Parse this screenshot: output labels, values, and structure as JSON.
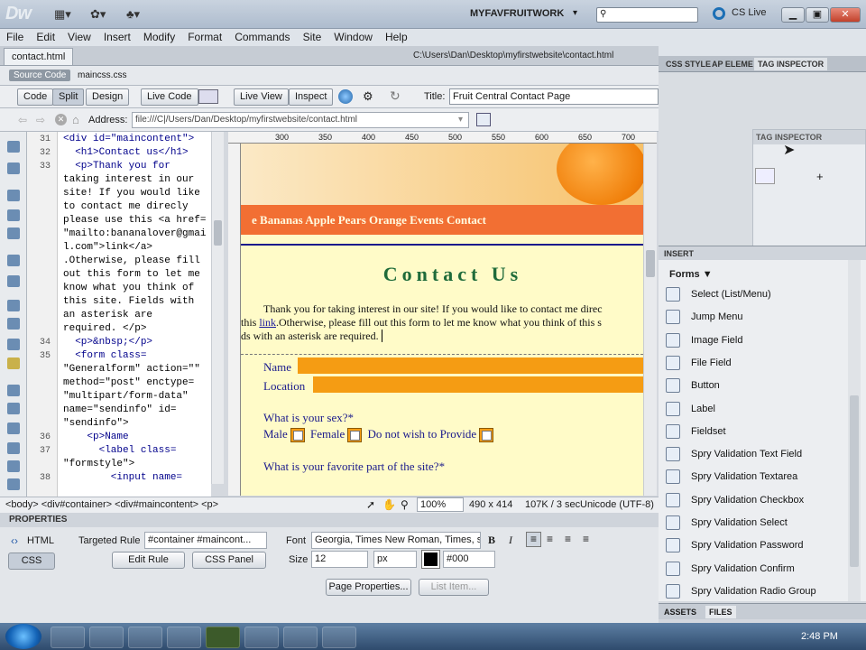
{
  "app": {
    "logo": "Dw",
    "workspace": "MYFAVFRUITWORK",
    "cs_live": "CS Live"
  },
  "menu": [
    "File",
    "Edit",
    "View",
    "Insert",
    "Modify",
    "Format",
    "Commands",
    "Site",
    "Window",
    "Help"
  ],
  "document": {
    "tab": "contact.html",
    "path": "C:\\Users\\Dan\\Desktop\\myfirstwebsite\\contact.html",
    "source_code": "Source Code",
    "related_file": "maincss.css"
  },
  "toolbar": {
    "code": "Code",
    "split": "Split",
    "design": "Design",
    "live_code": "Live Code",
    "live_view": "Live View",
    "inspect": "Inspect",
    "title_label": "Title:",
    "title_value": "Fruit Central Contact Page"
  },
  "address": {
    "label": "Address:",
    "value": "file:///C|/Users/Dan/Desktop/myfirstwebsite/contact.html"
  },
  "code_lines": [
    {
      "num": "31",
      "text": "<div id=\"maincontent\">"
    },
    {
      "num": "32",
      "text": "  <h1>Contact us</h1>"
    },
    {
      "num": "33",
      "text": "  <p>Thank you for"
    },
    {
      "num": "",
      "text": "taking interest in our"
    },
    {
      "num": "",
      "text": "site! If you would like"
    },
    {
      "num": "",
      "text": "to contact me direcly"
    },
    {
      "num": "",
      "text": "please use this <a href="
    },
    {
      "num": "",
      "text": "\"mailto:bananalover@gmai"
    },
    {
      "num": "",
      "text": "l.com\">link</a>"
    },
    {
      "num": "",
      "text": ".Otherwise, please fill"
    },
    {
      "num": "",
      "text": "out this form to let me"
    },
    {
      "num": "",
      "text": "know what you think of"
    },
    {
      "num": "",
      "text": "this site. Fields with"
    },
    {
      "num": "",
      "text": "an asterisk are"
    },
    {
      "num": "",
      "text": "required. </p>"
    },
    {
      "num": "34",
      "text": "  <p>&nbsp;</p>"
    },
    {
      "num": "35",
      "text": "  <form class="
    },
    {
      "num": "",
      "text": "\"Generalform\" action=\"\""
    },
    {
      "num": "",
      "text": "method=\"post\" enctype="
    },
    {
      "num": "",
      "text": "\"multipart/form-data\""
    },
    {
      "num": "",
      "text": "name=\"sendinfo\" id="
    },
    {
      "num": "",
      "text": "\"sendinfo\">"
    },
    {
      "num": "36",
      "text": "    <p>Name"
    },
    {
      "num": "37",
      "text": "      <label class="
    },
    {
      "num": "",
      "text": "\"formstyle\">"
    },
    {
      "num": "38",
      "text": "        <input name="
    }
  ],
  "ruler_marks": [
    "300",
    "350",
    "400",
    "450",
    "500",
    "550",
    "600",
    "650",
    "700"
  ],
  "design": {
    "nav": "e Bananas Apple Pears Orange Events Contact",
    "heading": "Contact Us",
    "para_line1": "Thank you for taking interest in our site! If you would like to contact me direc",
    "para_line2_pre": "this ",
    "para_link": "link",
    "para_line2_post": ".Otherwise, please fill out this form to let me know what you think of this s",
    "para_line3": "ds with an asterisk are required.",
    "name_label": "Name",
    "location_label": "Location",
    "sex_q": "What is your sex?*",
    "male": "Male",
    "female": "Female",
    "no_provide": "Do not wish to Provide",
    "fav_q": "What is your favorite part of the site?*"
  },
  "status": {
    "tags": "<body> <div#container> <div#maincontent> <p>",
    "zoom": "100%",
    "dims": "490 x 414",
    "size": "107K / 3 sec",
    "encoding": "Unicode (UTF-8)"
  },
  "properties": {
    "header": "PROPERTIES",
    "html": "HTML",
    "css": "CSS",
    "targeted_rule_label": "Targeted Rule",
    "targeted_rule": "#container #maincont...",
    "edit_rule": "Edit Rule",
    "css_panel": "CSS Panel",
    "font_label": "Font",
    "font_value": "Georgia, Times New Roman, Times, s",
    "size_label": "Size",
    "size_value": "12",
    "unit": "px",
    "color_value": "#000",
    "page_properties": "Page Properties...",
    "list_item": "List Item..."
  },
  "right_tabs": {
    "css_styles": "CSS STYLE",
    "ap": "AP ELEME",
    "tag_inspector": "TAG INSPECTOR",
    "ghost": "TAG INSPECTOR"
  },
  "insert": {
    "header": "INSERT",
    "category": "Forms",
    "items": [
      "Select (List/Menu)",
      "Jump Menu",
      "Image Field",
      "File Field",
      "Button",
      "Label",
      "Fieldset",
      "Spry Validation Text Field",
      "Spry Validation Textarea",
      "Spry Validation Checkbox",
      "Spry Validation Select",
      "Spry Validation Password",
      "Spry Validation Confirm",
      "Spry Validation Radio Group"
    ]
  },
  "files_tabs": {
    "assets": "ASSETS",
    "files": "FILES"
  },
  "taskbar": {
    "clock": "2:48 PM"
  }
}
